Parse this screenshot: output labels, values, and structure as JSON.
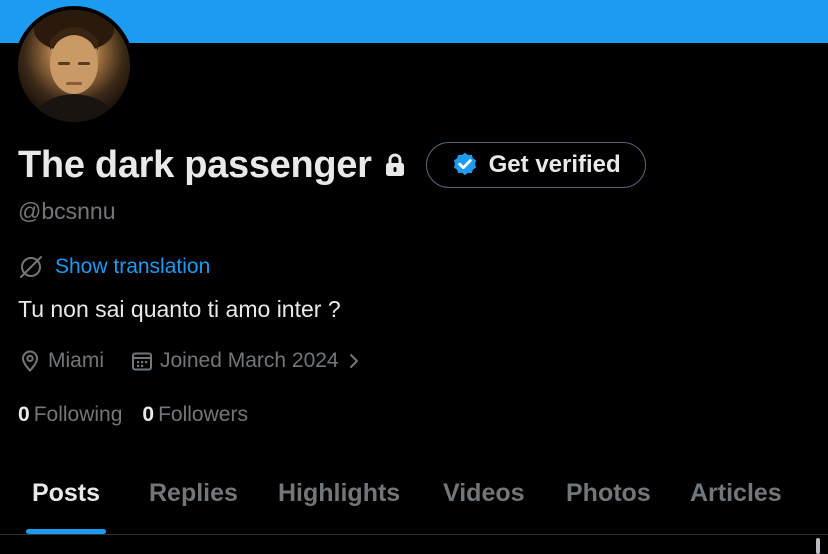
{
  "profile": {
    "display_name": "The dark passenger",
    "handle": "@bcsnnu",
    "get_verified_label": "Get verified",
    "show_translation_label": "Show translation",
    "bio": "Tu non sai quanto ti amo inter ?",
    "location": "Miami",
    "joined": "Joined March 2024",
    "following_count": "0",
    "following_label": "Following",
    "followers_count": "0",
    "followers_label": "Followers"
  },
  "tabs": [
    {
      "label": "Posts",
      "active": true
    },
    {
      "label": "Replies",
      "active": false
    },
    {
      "label": "Highlights",
      "active": false
    },
    {
      "label": "Videos",
      "active": false
    },
    {
      "label": "Photos",
      "active": false
    },
    {
      "label": "Articles",
      "active": false
    }
  ],
  "colors": {
    "background": "#000000",
    "banner": "#1d9bf0",
    "accent": "#1d9bf0",
    "primary_text": "#e7e9ea",
    "secondary_text": "#71767b",
    "border": "#536471"
  },
  "icons": [
    "lock-icon",
    "verified-badge-icon",
    "translate-icon",
    "location-pin-icon",
    "calendar-icon",
    "chevron-right-icon"
  ]
}
